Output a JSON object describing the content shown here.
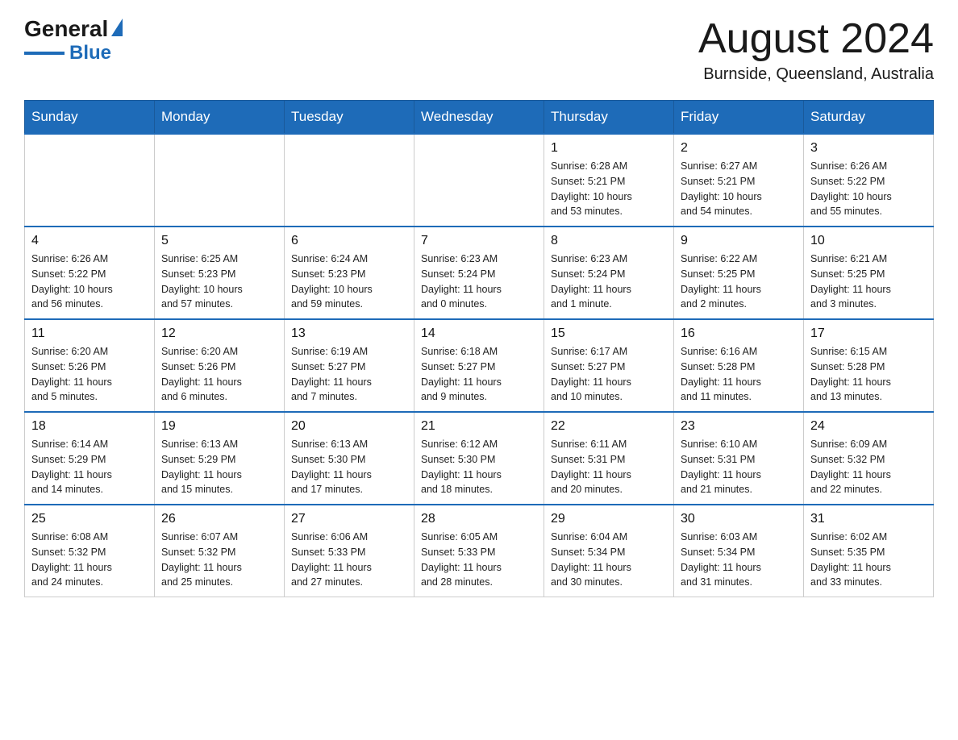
{
  "logo": {
    "general": "General",
    "blue": "Blue"
  },
  "header": {
    "month": "August 2024",
    "location": "Burnside, Queensland, Australia"
  },
  "weekdays": [
    "Sunday",
    "Monday",
    "Tuesday",
    "Wednesday",
    "Thursday",
    "Friday",
    "Saturday"
  ],
  "weeks": [
    [
      {
        "day": "",
        "info": ""
      },
      {
        "day": "",
        "info": ""
      },
      {
        "day": "",
        "info": ""
      },
      {
        "day": "",
        "info": ""
      },
      {
        "day": "1",
        "info": "Sunrise: 6:28 AM\nSunset: 5:21 PM\nDaylight: 10 hours\nand 53 minutes."
      },
      {
        "day": "2",
        "info": "Sunrise: 6:27 AM\nSunset: 5:21 PM\nDaylight: 10 hours\nand 54 minutes."
      },
      {
        "day": "3",
        "info": "Sunrise: 6:26 AM\nSunset: 5:22 PM\nDaylight: 10 hours\nand 55 minutes."
      }
    ],
    [
      {
        "day": "4",
        "info": "Sunrise: 6:26 AM\nSunset: 5:22 PM\nDaylight: 10 hours\nand 56 minutes."
      },
      {
        "day": "5",
        "info": "Sunrise: 6:25 AM\nSunset: 5:23 PM\nDaylight: 10 hours\nand 57 minutes."
      },
      {
        "day": "6",
        "info": "Sunrise: 6:24 AM\nSunset: 5:23 PM\nDaylight: 10 hours\nand 59 minutes."
      },
      {
        "day": "7",
        "info": "Sunrise: 6:23 AM\nSunset: 5:24 PM\nDaylight: 11 hours\nand 0 minutes."
      },
      {
        "day": "8",
        "info": "Sunrise: 6:23 AM\nSunset: 5:24 PM\nDaylight: 11 hours\nand 1 minute."
      },
      {
        "day": "9",
        "info": "Sunrise: 6:22 AM\nSunset: 5:25 PM\nDaylight: 11 hours\nand 2 minutes."
      },
      {
        "day": "10",
        "info": "Sunrise: 6:21 AM\nSunset: 5:25 PM\nDaylight: 11 hours\nand 3 minutes."
      }
    ],
    [
      {
        "day": "11",
        "info": "Sunrise: 6:20 AM\nSunset: 5:26 PM\nDaylight: 11 hours\nand 5 minutes."
      },
      {
        "day": "12",
        "info": "Sunrise: 6:20 AM\nSunset: 5:26 PM\nDaylight: 11 hours\nand 6 minutes."
      },
      {
        "day": "13",
        "info": "Sunrise: 6:19 AM\nSunset: 5:27 PM\nDaylight: 11 hours\nand 7 minutes."
      },
      {
        "day": "14",
        "info": "Sunrise: 6:18 AM\nSunset: 5:27 PM\nDaylight: 11 hours\nand 9 minutes."
      },
      {
        "day": "15",
        "info": "Sunrise: 6:17 AM\nSunset: 5:27 PM\nDaylight: 11 hours\nand 10 minutes."
      },
      {
        "day": "16",
        "info": "Sunrise: 6:16 AM\nSunset: 5:28 PM\nDaylight: 11 hours\nand 11 minutes."
      },
      {
        "day": "17",
        "info": "Sunrise: 6:15 AM\nSunset: 5:28 PM\nDaylight: 11 hours\nand 13 minutes."
      }
    ],
    [
      {
        "day": "18",
        "info": "Sunrise: 6:14 AM\nSunset: 5:29 PM\nDaylight: 11 hours\nand 14 minutes."
      },
      {
        "day": "19",
        "info": "Sunrise: 6:13 AM\nSunset: 5:29 PM\nDaylight: 11 hours\nand 15 minutes."
      },
      {
        "day": "20",
        "info": "Sunrise: 6:13 AM\nSunset: 5:30 PM\nDaylight: 11 hours\nand 17 minutes."
      },
      {
        "day": "21",
        "info": "Sunrise: 6:12 AM\nSunset: 5:30 PM\nDaylight: 11 hours\nand 18 minutes."
      },
      {
        "day": "22",
        "info": "Sunrise: 6:11 AM\nSunset: 5:31 PM\nDaylight: 11 hours\nand 20 minutes."
      },
      {
        "day": "23",
        "info": "Sunrise: 6:10 AM\nSunset: 5:31 PM\nDaylight: 11 hours\nand 21 minutes."
      },
      {
        "day": "24",
        "info": "Sunrise: 6:09 AM\nSunset: 5:32 PM\nDaylight: 11 hours\nand 22 minutes."
      }
    ],
    [
      {
        "day": "25",
        "info": "Sunrise: 6:08 AM\nSunset: 5:32 PM\nDaylight: 11 hours\nand 24 minutes."
      },
      {
        "day": "26",
        "info": "Sunrise: 6:07 AM\nSunset: 5:32 PM\nDaylight: 11 hours\nand 25 minutes."
      },
      {
        "day": "27",
        "info": "Sunrise: 6:06 AM\nSunset: 5:33 PM\nDaylight: 11 hours\nand 27 minutes."
      },
      {
        "day": "28",
        "info": "Sunrise: 6:05 AM\nSunset: 5:33 PM\nDaylight: 11 hours\nand 28 minutes."
      },
      {
        "day": "29",
        "info": "Sunrise: 6:04 AM\nSunset: 5:34 PM\nDaylight: 11 hours\nand 30 minutes."
      },
      {
        "day": "30",
        "info": "Sunrise: 6:03 AM\nSunset: 5:34 PM\nDaylight: 11 hours\nand 31 minutes."
      },
      {
        "day": "31",
        "info": "Sunrise: 6:02 AM\nSunset: 5:35 PM\nDaylight: 11 hours\nand 33 minutes."
      }
    ]
  ]
}
